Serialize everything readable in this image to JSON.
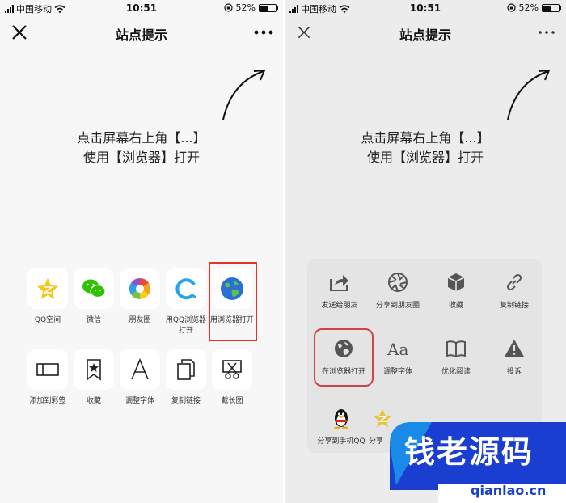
{
  "statusbar": {
    "carrier": "中国移动",
    "time": "10:51",
    "battery": "52%",
    "battery_level": 0.52
  },
  "navbar": {
    "title": "站点提示"
  },
  "hint": {
    "line1": "点击屏幕右上角【...】",
    "line2": "使用【浏览器】打开"
  },
  "left_menu": {
    "items": [
      {
        "label": "QQ空间",
        "icon": "qzone-star-icon"
      },
      {
        "label": "微信",
        "icon": "wechat-icon"
      },
      {
        "label": "朋友圈",
        "icon": "moments-icon"
      },
      {
        "label": "用QQ浏览器打开",
        "icon": "qq-browser-icon"
      },
      {
        "label": "用浏览器打开",
        "icon": "globe-icon"
      },
      {
        "label": "添加到彩签",
        "icon": "tag-rect-icon"
      },
      {
        "label": "收藏",
        "icon": "bookmark-star-icon"
      },
      {
        "label": "调整字体",
        "icon": "font-a-icon"
      },
      {
        "label": "复制链接",
        "icon": "copy-icon"
      },
      {
        "label": "截长图",
        "icon": "scissors-icon"
      }
    ]
  },
  "right_menu": {
    "items": [
      {
        "label": "发送给朋友",
        "icon": "share-arrow-icon"
      },
      {
        "label": "分享到朋友圈",
        "icon": "aperture-icon"
      },
      {
        "label": "收藏",
        "icon": "cube-icon"
      },
      {
        "label": "复制链接",
        "icon": "link-icon"
      },
      {
        "label": "在浏览器打开",
        "icon": "globe-icon"
      },
      {
        "label": "调整字体",
        "icon": "font-aa-icon"
      },
      {
        "label": "优化阅读",
        "icon": "book-icon"
      },
      {
        "label": "投诉",
        "icon": "warning-icon"
      },
      {
        "label": "分享到手机QQ",
        "icon": "qq-penguin-icon"
      },
      {
        "label": "分享",
        "icon": "qzone-star-icon"
      }
    ]
  },
  "watermark": {
    "title": "钱老源码",
    "url": "qianlao.cn"
  },
  "colors": {
    "highlight": "#e0342c",
    "wechat_green": "#2dc100",
    "globe_blue": "#2a6fd6",
    "watermark_blue": "#1a3ecf"
  }
}
